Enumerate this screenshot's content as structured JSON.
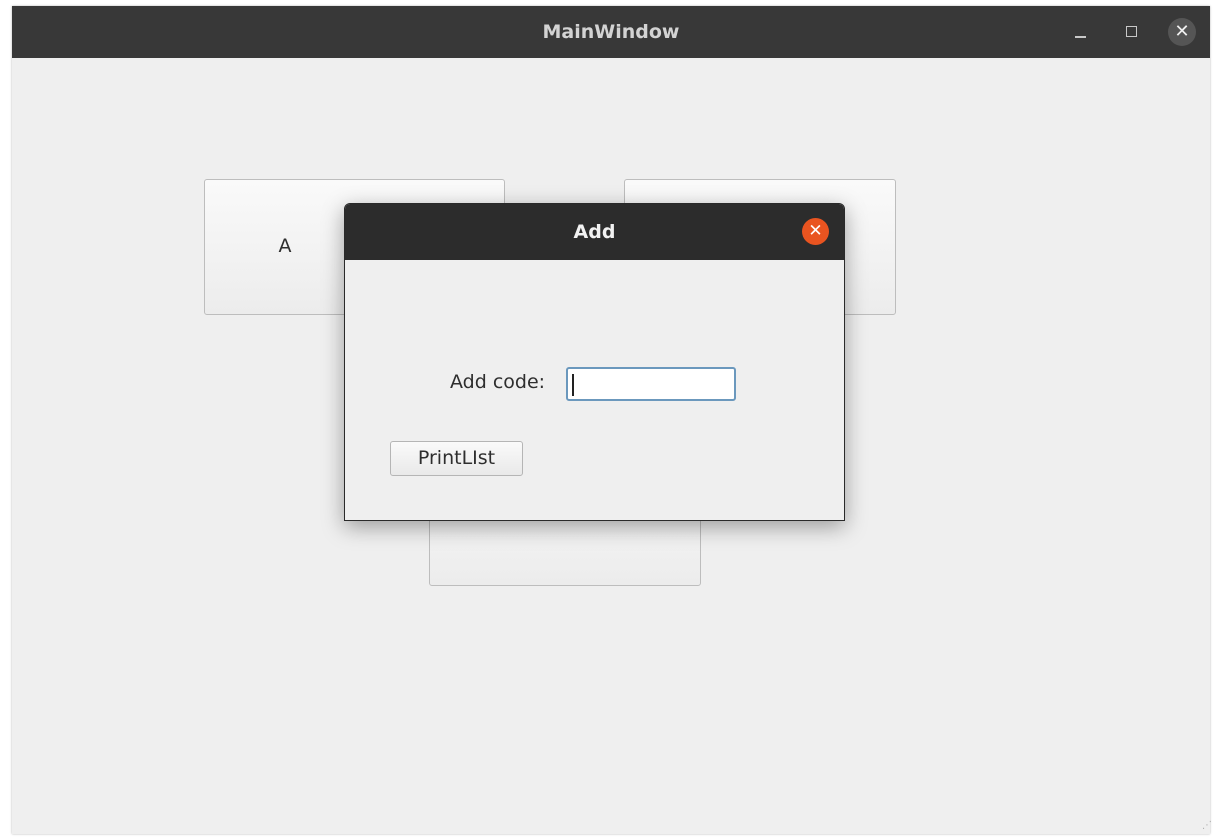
{
  "main_window": {
    "title": "MainWindow",
    "controls": {
      "minimize_icon": "minimize-icon",
      "maximize_icon": "maximize-icon",
      "close_icon": "close-icon",
      "close_glyph": "✕"
    }
  },
  "background_buttons": {
    "first_label_visible": "A"
  },
  "dialog": {
    "title": "Add",
    "close_glyph": "✕",
    "add_code_label": "Add code:",
    "add_code_value": "",
    "print_list_label": "PrintLIst",
    "accent_color": "#e95420"
  }
}
